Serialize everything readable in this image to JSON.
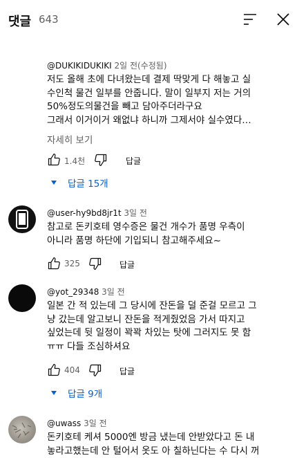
{
  "header": {
    "title": "댓글",
    "count": "643"
  },
  "comments": [
    {
      "author": "@DUKIKIDUKIKI",
      "time": "2일 전(수정됨)",
      "lines": [
        "저도 올해 초에 다녀왔는데 결제 딱맞게 다 해놓고 실",
        "수인척 물건 일부를 안줍니다. 말이 일부지 저는 거의",
        "50%정도의물건을 빼고 담아주더라구요",
        "그래서 이거이거 왜없냐 하니까 그제서야 실수였다…"
      ],
      "more": "자세히 보기",
      "likes": "1.4천",
      "reply": "답글",
      "replies": "답글 15개"
    },
    {
      "author": "@user-hy9bd8jr1t",
      "time": "3일 전",
      "lines": [
        "참고로 돈키호테 영수증은 물건 개수가 품명 우측이",
        "아니라 품명 하단에 기입되니 참고해주세요~"
      ],
      "likes": "325",
      "reply": "답글"
    },
    {
      "author": "@yot_29348",
      "time": "3일 전",
      "lines": [
        "일본 간 적 있는데 그 당시에 잔돈을 덜 준걸 모르고 그",
        "냥 갔는데 알고보니 잔돈을 적게줬었음 가서 따지고",
        "싶었는데 뒷 일정이 꽉꽉 차있는 탓에 그러지도 못 함",
        "ㅠㅠ 다들 조심하셔요"
      ],
      "likes": "404",
      "reply": "답글",
      "replies": "답글 9개"
    },
    {
      "author": "@uwass",
      "time": "3일 전",
      "lines": [
        "돈키호테 케셔 5000엔 방금 냈는데 안받았다고 돈 내",
        "놓라고했는데 안 털어서 옷도 아 칠하닌다는 수 다시 꺼"
      ]
    }
  ]
}
